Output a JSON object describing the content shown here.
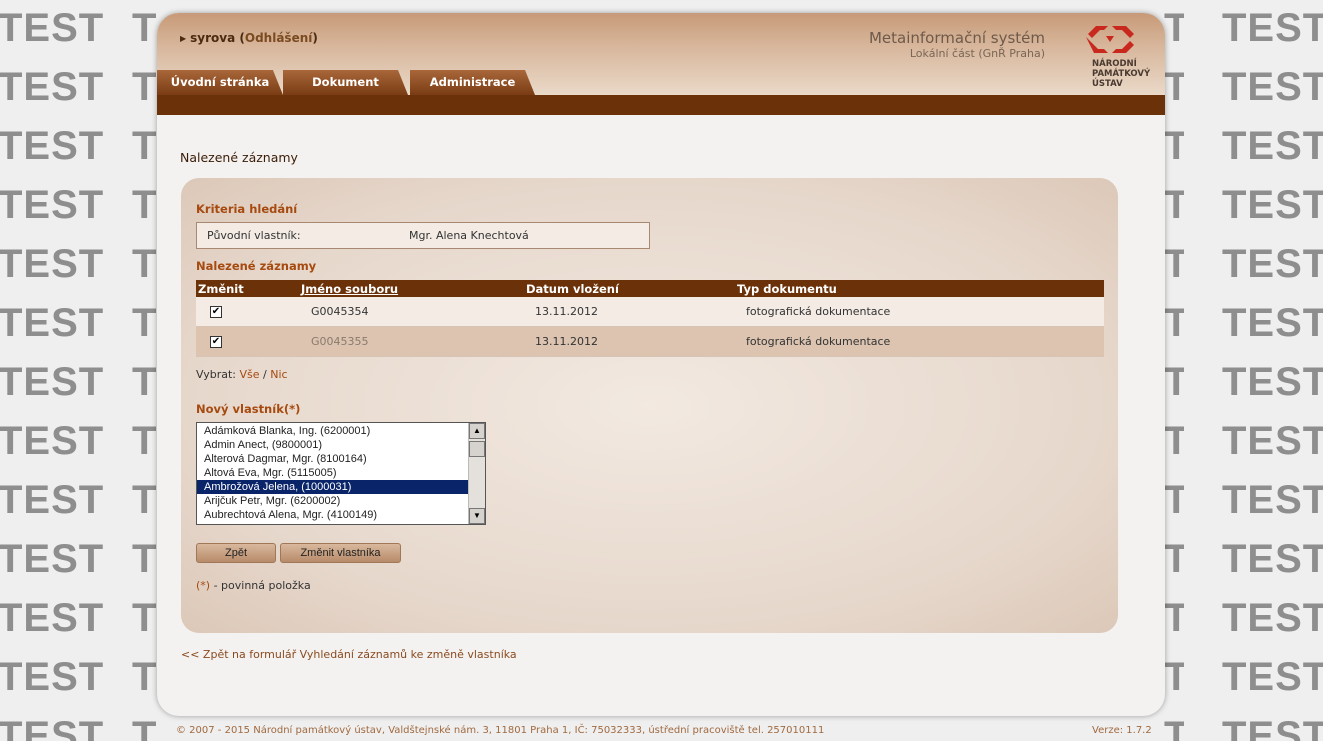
{
  "watermark": "TEST",
  "header": {
    "user": "syrova",
    "logout": "Odhlášení",
    "system_title": "Metainformační systém",
    "system_subtitle": "Lokální část (GnŘ Praha)",
    "logo_line1": "NÁRODNÍ",
    "logo_line2": "PAMÁTKOVÝ",
    "logo_line3": "ÚSTAV"
  },
  "tabs": [
    {
      "label": "Úvodní stránka"
    },
    {
      "label": "Dokument"
    },
    {
      "label": "Administrace"
    }
  ],
  "page_title": "Nalezené záznamy",
  "criteria": {
    "title": "Kriteria hledání",
    "key": "Původní vlastník:",
    "value": "Mgr. Alena Knechtová"
  },
  "results": {
    "title": "Nalezené záznamy",
    "columns": {
      "change": "Změnit",
      "filename": "Jméno souboru",
      "date": "Datum vložení",
      "type": "Typ dokumentu"
    },
    "rows": [
      {
        "checked": true,
        "filename": "G0045354",
        "date": "13.11.2012",
        "type": "fotografická dokumentace"
      },
      {
        "checked": true,
        "filename": "G0045355",
        "date": "13.11.2012",
        "type": "fotografická dokumentace"
      }
    ]
  },
  "select": {
    "label": "Vybrat:",
    "all": "Vše",
    "sep": "/",
    "none": "Nic"
  },
  "new_owner": {
    "label": "Nový vlastník(*)",
    "options": [
      "Adámková Blanka, Ing. (6200001)",
      "Admin Anect, (9800001)",
      "Alterová Dagmar, Mgr. (8100164)",
      "Altová Eva, Mgr. (5115005)",
      "Ambrožová Jelena, (1000031)",
      "Arijčuk Petr, Mgr. (6200002)",
      "Aubrechtová Alena, Mgr. (4100149)"
    ],
    "selected_index": 4
  },
  "buttons": {
    "back": "Zpět",
    "change_owner": "Změnit vlastníka"
  },
  "required_note": {
    "star": "(*)",
    "text": " - povinná položka"
  },
  "back_link": "<< Zpět na formulář Vyhledání záznamů ke změně vlastníka",
  "footer": {
    "copyright": "© 2007 - 2015 Národní památkový ústav, Valdštejnské nám. 3, 11801 Praha 1, IČ: 75032333, ústřední pracoviště tel. 257010111",
    "version": "Verze: 1.7.2"
  },
  "colors": {
    "accent": "#6b3108",
    "link": "#a64a10",
    "selection": "#0a246a"
  }
}
